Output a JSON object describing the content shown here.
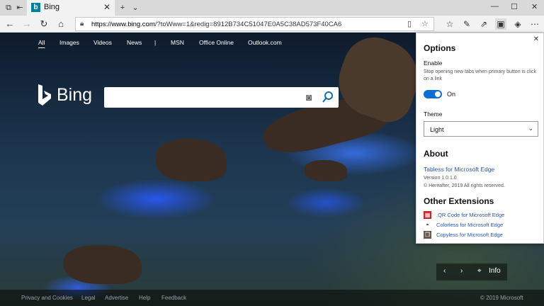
{
  "browser": {
    "tab_title": "Bing",
    "tab_favicon": "b",
    "url_scheme_host": "https://www.bing.com",
    "url_rest": "/?toWww=1&redig=8912B734C51047E0A5C38AD573F40CA6"
  },
  "bing": {
    "nav": [
      "All",
      "Images",
      "Videos",
      "News",
      "MSN",
      "Office Online",
      "Outlook.com"
    ],
    "nav_separator": "|",
    "logo_text": "Bing",
    "pager_info": "Info",
    "footer_links": [
      "Privacy and Cookies",
      "Legal",
      "Advertise",
      "Help",
      "Feedback"
    ],
    "copyright": "© 2019 Microsoft"
  },
  "popup": {
    "title": "Options",
    "enable_label": "Enable",
    "enable_desc": "Stop opening new tabs when primary button is click on a link",
    "toggle_label": "On",
    "toggle_on": true,
    "theme_label": "Theme",
    "theme_value": "Light",
    "about_title": "About",
    "about_link": "Tabless for Microsoft Edge",
    "version": "Version 1.0.1.0",
    "copyright": "© Hereafter, 2019 All rights reserved.",
    "other_title": "Other Extensions",
    "extensions": [
      {
        "icon": "qr-code-icon",
        "label": ".QR Code for Microsoft Edge",
        "color": "#c62828"
      },
      {
        "icon": "palette-icon",
        "label": "Colorless for Microsoft Edge",
        "color": "#333333"
      },
      {
        "icon": "copy-icon",
        "label": "Copyless for Microsoft Edge",
        "color": "#6d5a4f"
      }
    ]
  },
  "colors": {
    "accent": "#0c6fd3",
    "link": "#2b56b0"
  }
}
